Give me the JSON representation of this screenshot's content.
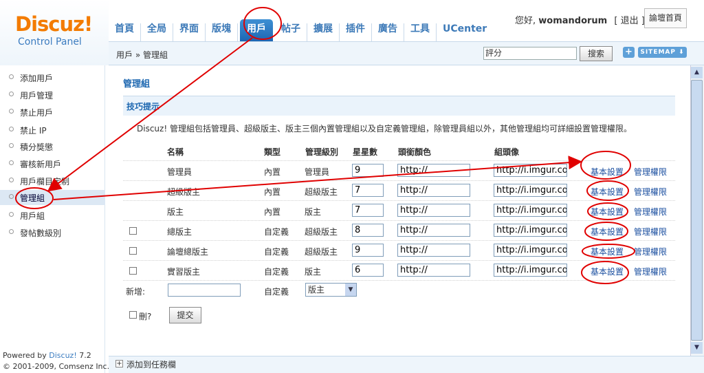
{
  "logo": {
    "main": "Discuz!",
    "sub": "Control Panel"
  },
  "nav": {
    "tabs": [
      "首頁",
      "全局",
      "界面",
      "版塊",
      "用戶",
      "帖子",
      "擴展",
      "插件",
      "廣告",
      "工具",
      "UCenter"
    ],
    "active": "用戶"
  },
  "user": {
    "greeting": "您好, ",
    "name": "womandorum",
    "logout": "[ 退出 ]",
    "home": "論壇首頁"
  },
  "subbar": {
    "breadcrumb": "用戶 » 管理組",
    "search_value": "評分",
    "search_button": "搜索",
    "plus": "+",
    "sitemap": "SITEMAP ⬇"
  },
  "sidebar": {
    "items": [
      "添加用戶",
      "用戶管理",
      "禁止用戶",
      "禁止 IP",
      "積分獎懲",
      "審核新用戶",
      "用戶欄目定制",
      "管理組",
      "用戶組",
      "發帖數級別"
    ],
    "active": "管理組",
    "powered_prefix": "Powered by ",
    "powered_name": "Discuz!",
    "powered_ver": " 7.2",
    "copyright": "© 2001-2009, Comsenz Inc."
  },
  "main": {
    "title": "管理組",
    "tip_title": "技巧提示",
    "tip_text": "Discuz! 管理組包括管理員、超級版主、版主三個內置管理組以及自定義管理組，除管理員組以外，其他管理組均可詳細設置管理權限。",
    "headers": [
      "名稱",
      "類型",
      "管理級別",
      "星星數",
      "頭銜顏色",
      "組頭像"
    ],
    "rows": [
      {
        "checkbox": false,
        "name": "管理員",
        "type": "內置",
        "level": "管理員",
        "stars": "9",
        "color": "http://",
        "avatar": "http://i.imgur.co",
        "basic": "基本設置",
        "perm": "管理權限"
      },
      {
        "checkbox": false,
        "name": "超級版主",
        "type": "內置",
        "level": "超級版主",
        "stars": "7",
        "color": "http://",
        "avatar": "http://i.imgur.co",
        "basic": "基本設置",
        "perm": "管理權限"
      },
      {
        "checkbox": false,
        "name": "版主",
        "type": "內置",
        "level": "版主",
        "stars": "7",
        "color": "http://",
        "avatar": "http://i.imgur.co",
        "basic": "基本設置",
        "perm": "管理權限"
      },
      {
        "checkbox": true,
        "name": "總版主",
        "type": "自定義",
        "level": "超級版主",
        "stars": "8",
        "color": "http://",
        "avatar": "http://i.imgur.co",
        "basic": "基本設置",
        "perm": "管理權限"
      },
      {
        "checkbox": true,
        "name": "論壇總版主",
        "type": "自定義",
        "level": "超級版主",
        "stars": "9",
        "color": "http://",
        "avatar": "http://i.imgur.co",
        "basic": "基本設置",
        "perm": "管理權限"
      },
      {
        "checkbox": true,
        "name": "實習版主",
        "type": "自定義",
        "level": "版主",
        "stars": "6",
        "color": "http://",
        "avatar": "http://i.imgur.co",
        "basic": "基本設置",
        "perm": "管理權限"
      }
    ],
    "new_label": "新增:",
    "new_type": "自定義",
    "new_level": "版主",
    "delete_label": "刪?",
    "submit": "提交"
  },
  "bottom": {
    "add_task": "添加到任務欄"
  },
  "colors": {
    "accent": "#1b66b0",
    "annotation": "#e00000",
    "logo": "#f37b00"
  }
}
